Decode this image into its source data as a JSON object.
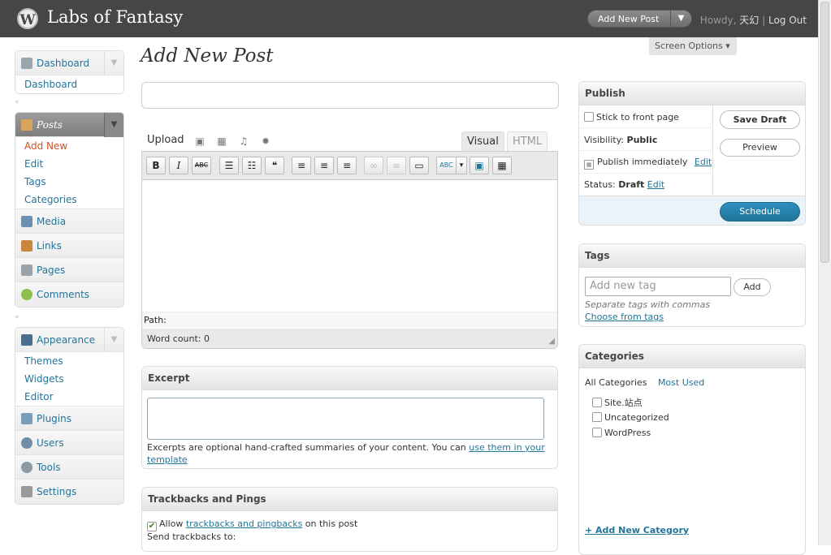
{
  "header": {
    "logo_letter": "W",
    "site_title": "Labs of Fantasy",
    "favorite_action": "Add New Post",
    "howdy": "Howdy,",
    "user": "天幻",
    "sep": "|",
    "logout": "Log Out"
  },
  "screen_options": "Screen Options ▾",
  "page_title": "Add New Post",
  "menu": {
    "dashboard": "Dashboard",
    "dashboard_sub": "Dashboard",
    "posts": "Posts",
    "posts_sub": [
      "Add New",
      "Edit",
      "Tags",
      "Categories"
    ],
    "media": "Media",
    "links": "Links",
    "pages": "Pages",
    "comments": "Comments",
    "appearance": "Appearance",
    "appearance_sub": [
      "Themes",
      "Widgets",
      "Editor"
    ],
    "plugins": "Plugins",
    "users": "Users",
    "tools": "Tools",
    "settings": "Settings",
    "separator_glyph": "«",
    "toggle_glyph": "▼"
  },
  "editor": {
    "upload_label": "Upload",
    "tab_visual": "Visual",
    "tab_html": "HTML",
    "path_label": "Path:",
    "word_count": "Word count: 0",
    "toolbar": {
      "bold": "B",
      "italic": "I",
      "strike": "ABC",
      "ul": "☰",
      "ol": "☷",
      "quote": "❝",
      "align_left": "≡",
      "align_center": "≡",
      "align_right": "≡",
      "link": "∞",
      "unlink": "∞",
      "more": "▭",
      "spell": "ABC",
      "spell_menu": "▾",
      "fullscreen": "▣",
      "kitchen": "▦"
    }
  },
  "excerpt": {
    "title": "Excerpt",
    "help_text": "Excerpts are optional hand-crafted summaries of your content. You can ",
    "help_link": "use them in your template"
  },
  "trackbacks": {
    "title": "Trackbacks and Pings",
    "allow_pre": "Allow ",
    "allow_link": "trackbacks and pingbacks",
    "allow_post": " on this post",
    "send_label": "Send trackbacks to:"
  },
  "publish": {
    "title": "Publish",
    "sticky": "Stick to front page",
    "visibility_label": "Visibility: ",
    "visibility_value": "Public",
    "publish_immediately": "Publish immediately",
    "edit": "Edit",
    "status_label": "Status: ",
    "status_value": "Draft",
    "save_draft": "Save Draft",
    "preview": "Preview",
    "schedule": "Schedule"
  },
  "tags": {
    "title": "Tags",
    "placeholder": "Add new tag",
    "add": "Add",
    "hint": "Separate tags with commas",
    "choose": "Choose from tags"
  },
  "categories": {
    "title": "Categories",
    "tab_all": "All Categories",
    "tab_used": "Most Used",
    "items": [
      "Site.站点",
      "Uncategorized",
      "WordPress"
    ],
    "add_new": "+ Add New Category"
  },
  "colors": {
    "header_bg": "#464646",
    "link": "#21759b",
    "active_menu": "#d54e21",
    "schedule_button": "#21759b"
  }
}
